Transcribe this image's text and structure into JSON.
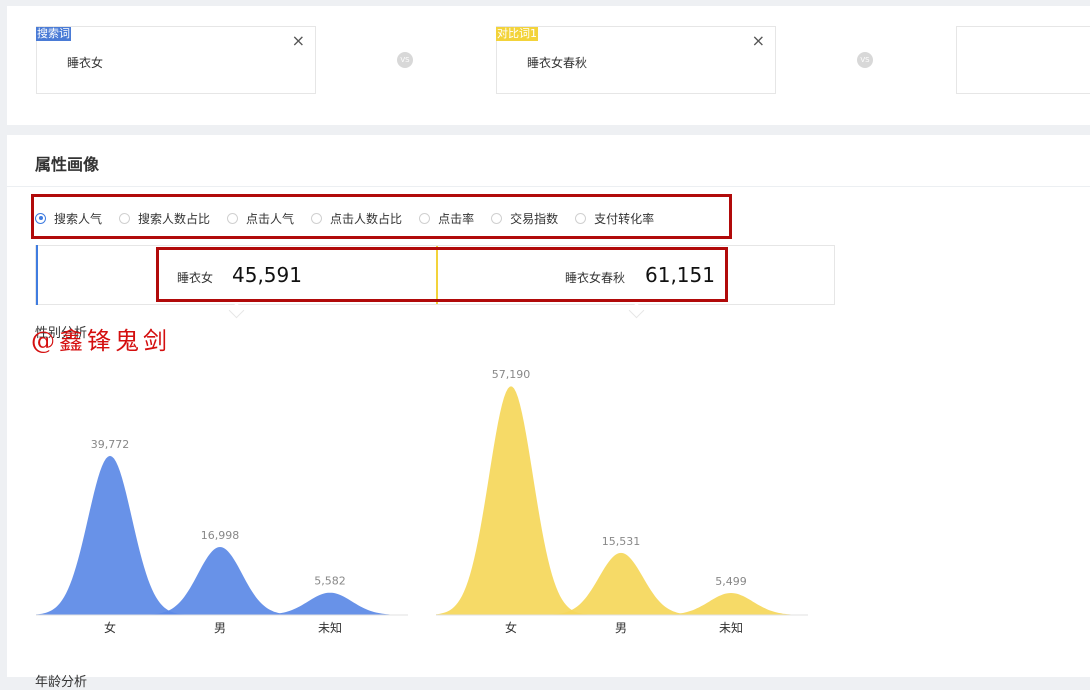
{
  "keywords": {
    "primary": {
      "tag": "搜索词",
      "text": "睡衣女"
    },
    "compare": {
      "tag": "对比词1",
      "text": "睡衣女春秋"
    },
    "vs_label": "VS",
    "close_symbol": "×"
  },
  "section": {
    "title": "属性画像",
    "metrics": [
      {
        "label": "搜索人气",
        "checked": true
      },
      {
        "label": "搜索人数占比",
        "checked": false
      },
      {
        "label": "点击人气",
        "checked": false
      },
      {
        "label": "点击人数占比",
        "checked": false
      },
      {
        "label": "点击率",
        "checked": false
      },
      {
        "label": "交易指数",
        "checked": false
      },
      {
        "label": "支付转化率",
        "checked": false
      }
    ],
    "comparison": [
      {
        "name": "睡衣女",
        "value": "45,591"
      },
      {
        "name": "睡衣女春秋",
        "value": "61,151"
      }
    ],
    "gender_title": "性别分析",
    "age_title": "年龄分析",
    "watermark": "@鑫锋鬼剑"
  },
  "colors": {
    "blue": "#5b89e6",
    "yellow": "#f5d75a",
    "accent_red": "#b10a0a"
  },
  "chart_data": [
    {
      "type": "area",
      "series_name": "睡衣女",
      "categories": [
        "女",
        "男",
        "未知"
      ],
      "values": [
        39772,
        16998,
        5582
      ],
      "labels": [
        "39,772",
        "16,998",
        "5,582"
      ],
      "color": "#5b89e6"
    },
    {
      "type": "area",
      "series_name": "睡衣女春秋",
      "categories": [
        "女",
        "男",
        "未知"
      ],
      "values": [
        57190,
        15531,
        5499
      ],
      "labels": [
        "57,190",
        "15,531",
        "5,499"
      ],
      "color": "#f5d75a"
    }
  ]
}
